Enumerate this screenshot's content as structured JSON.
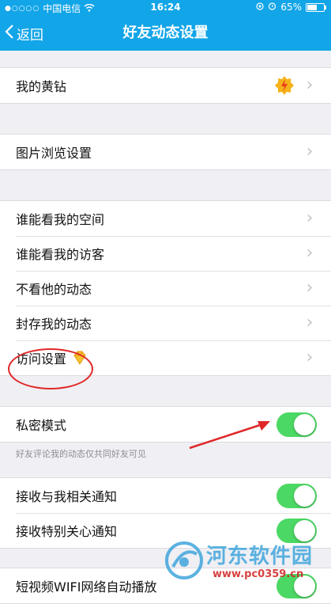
{
  "status_bar": {
    "carrier": "中国电信",
    "time": "16:24",
    "battery": "65%",
    "battery_level": 0.65
  },
  "nav": {
    "back_label": "返回",
    "title": "好友动态设置"
  },
  "sections": {
    "s1": {
      "row1_label": "我的黄钻",
      "yellow_badge_icon": "yellow-diamond-badge-icon"
    },
    "s2": {
      "row1_label": "图片浏览设置"
    },
    "s3": {
      "rows": [
        "谁能看我的空间",
        "谁能看我的访客",
        "不看他的动态",
        "封存我的动态",
        "访问设置"
      ],
      "diamond_icon": "yellow-diamond-icon"
    },
    "s4": {
      "label": "私密模式",
      "hint": "好友评论我的动态仅共同好友可见",
      "toggle_on": true
    },
    "s5": {
      "rows": [
        "接收与我相关通知",
        "接收特别关心通知",
        "短视频WIFI网络自动播放"
      ],
      "toggles_on": [
        true,
        true,
        true
      ]
    }
  },
  "watermark": {
    "title": "河东软件园",
    "url": "www.pc0359.cn"
  },
  "colors": {
    "accent": "#12a5e8",
    "toggle_on": "#4cd864",
    "highlight": "#e02828",
    "background": "#efeff4"
  }
}
